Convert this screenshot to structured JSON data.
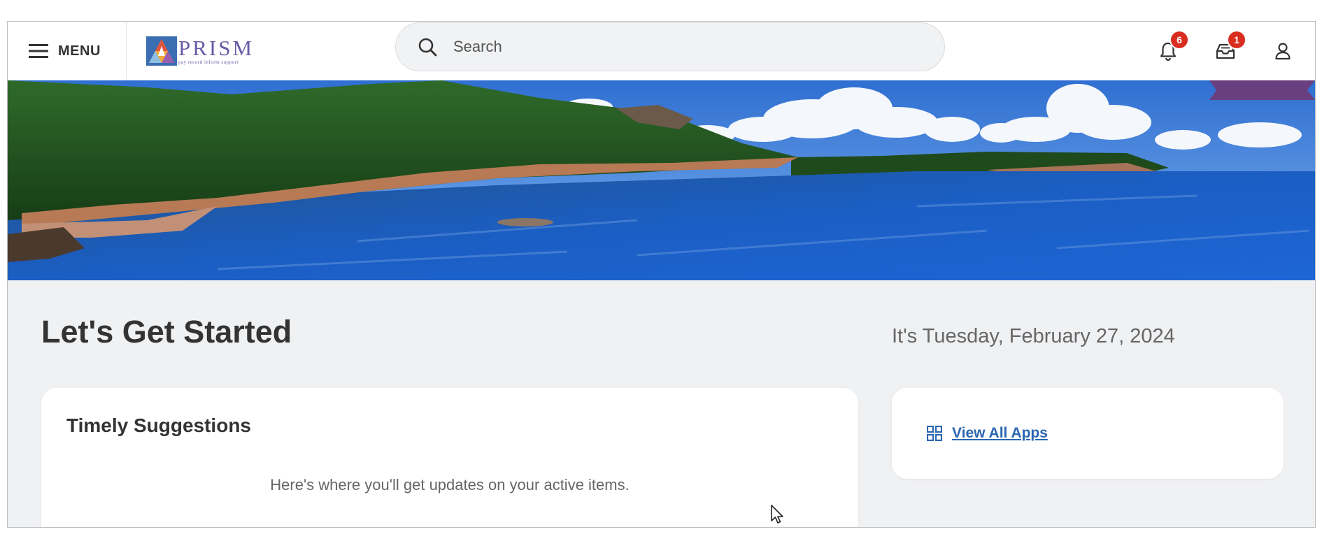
{
  "header": {
    "menu_label": "MENU",
    "logo_word": "PRISM",
    "logo_tagline": "pay record inform support",
    "search_placeholder": "Search",
    "notifications_count": "6",
    "inbox_count": "1"
  },
  "main": {
    "title": "Let's Get Started",
    "date": "It's Tuesday, February 27, 2024",
    "suggestions": {
      "title": "Timely Suggestions",
      "empty_text": "Here's where you'll get updates on your active items."
    },
    "apps": {
      "link_label": "View All Apps"
    }
  },
  "colors": {
    "badge": "#d92d20",
    "link": "#2b66b1",
    "brand": "#6b5aa6",
    "ribbon": "#6a3f7f"
  },
  "icons": [
    "hamburger-icon",
    "bell-icon",
    "inbox-icon",
    "user-icon",
    "search-icon",
    "grid-icon",
    "cursor-icon"
  ]
}
